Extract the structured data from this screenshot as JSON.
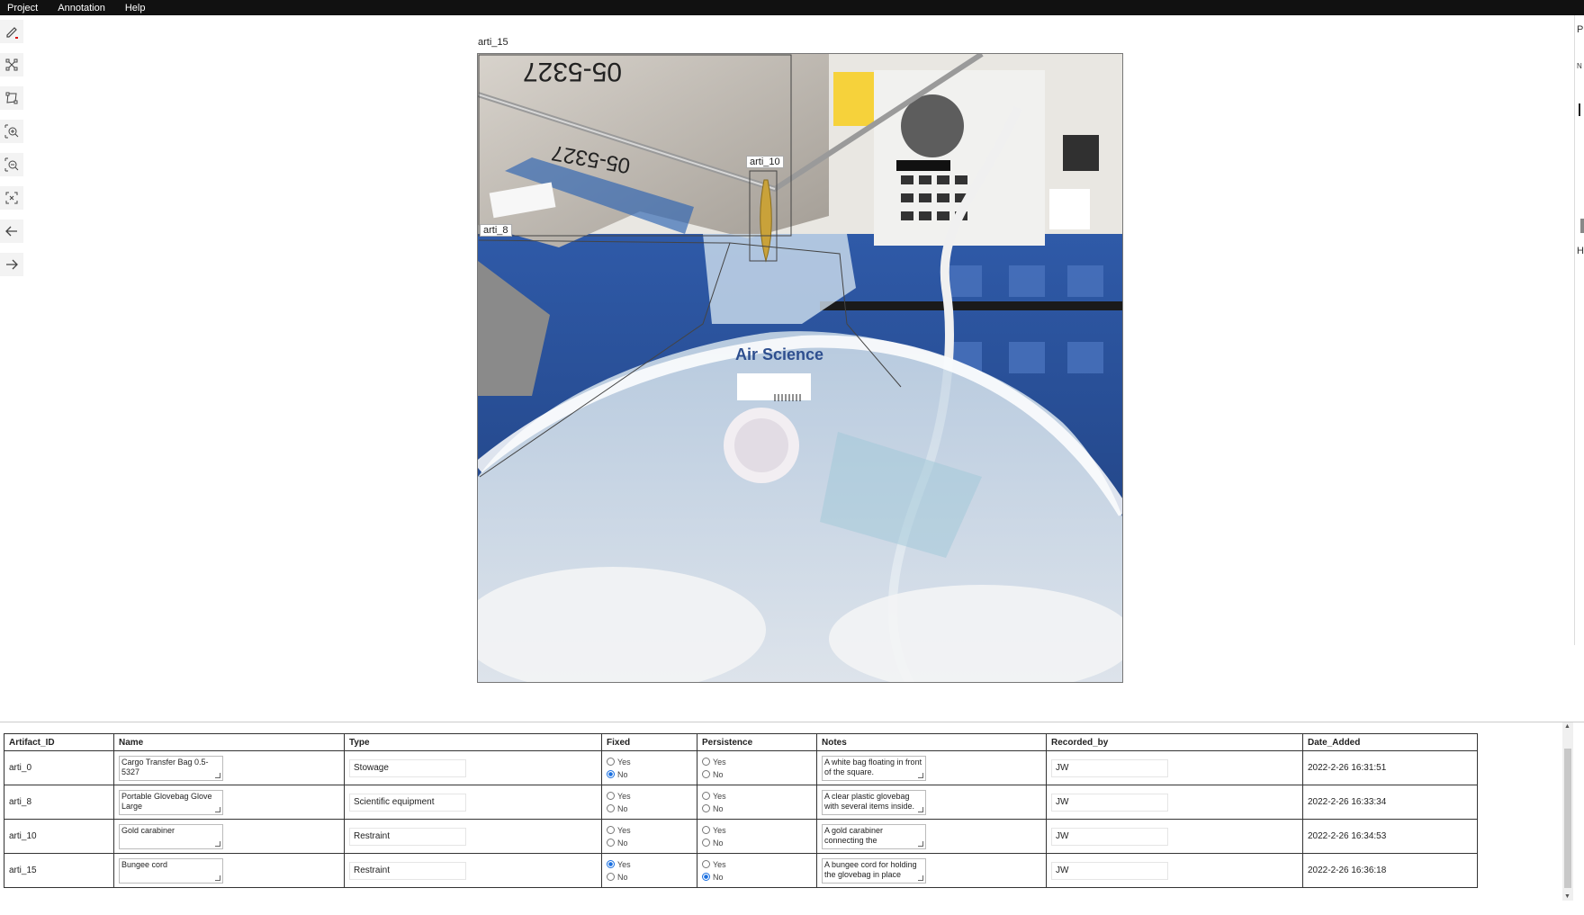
{
  "menu": [
    "Project",
    "Annotation",
    "Help"
  ],
  "tools": [
    {
      "icon": "pencil-icon"
    },
    {
      "icon": "connect-regions-icon"
    },
    {
      "icon": "polygon-edit-icon"
    },
    {
      "icon": "zoom-in-icon"
    },
    {
      "icon": "zoom-out-icon"
    },
    {
      "icon": "fit-view-icon"
    },
    {
      "icon": "arrow-left-icon"
    },
    {
      "icon": "arrow-right-icon"
    }
  ],
  "regions": {
    "r15": "arti_15",
    "r10": "arti_10",
    "r8": "arti_8"
  },
  "image_text": {
    "bag_code_1": "05-5327",
    "bag_code_2": "05-5327",
    "brand": "Air Science"
  },
  "right_panel": {
    "p": "P",
    "n": "N",
    "h": "H"
  },
  "table": {
    "headers": {
      "id": "Artifact_ID",
      "name": "Name",
      "type": "Type",
      "fixed": "Fixed",
      "persistence": "Persistence",
      "notes": "Notes",
      "recorded_by": "Recorded_by",
      "date": "Date_Added"
    },
    "yes": "Yes",
    "no": "No",
    "rows": [
      {
        "id": "arti_0",
        "name": "Cargo Transfer Bag 0.5-5327",
        "type": "Stowage",
        "notes": "A white bag floating in front of the square.",
        "recorded_by": "JW",
        "date": "2022-2-26 16:31:51"
      },
      {
        "id": "arti_8",
        "name": "Portable Glovebag Glove Large",
        "type": "Scientific equipment",
        "notes": "A clear plastic glovebag with several items inside.",
        "recorded_by": "JW",
        "date": "2022-2-26 16:33:34"
      },
      {
        "id": "arti_10",
        "name": "Gold carabiner",
        "type": "Restraint",
        "notes": "A gold carabiner connecting the",
        "recorded_by": "JW",
        "date": "2022-2-26 16:34:53"
      },
      {
        "id": "arti_15",
        "name": "Bungee cord",
        "type": "Restraint",
        "notes": "A bungee cord for holding the glovebag in place",
        "recorded_by": "JW",
        "date": "2022-2-26 16:36:18"
      }
    ],
    "fixed_selection": [
      "No",
      "",
      "",
      "Yes"
    ],
    "persistence_selection": [
      "No",
      "",
      "",
      "No"
    ]
  }
}
